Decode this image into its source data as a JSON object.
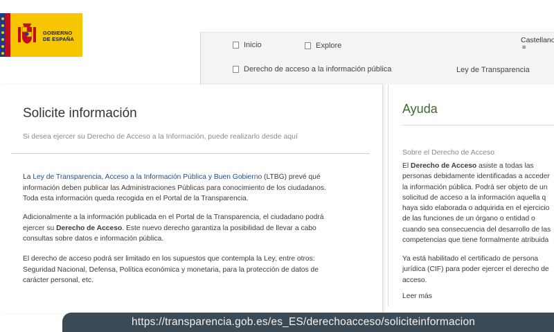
{
  "logo": {
    "line1": "GOBIERNO",
    "line2": "DE ESPAÑA",
    "colors": {
      "background": "#f6c700",
      "eu_blue": "#1f3b8c",
      "red": "#c60b1e"
    }
  },
  "nav": {
    "items": [
      {
        "label": "Inicio"
      },
      {
        "label": "Explore"
      },
      {
        "label": "Derecho de acceso a la información pública"
      },
      {
        "label": "Ley de Transparencia"
      }
    ],
    "language": "Castellano"
  },
  "main": {
    "title": "Solicite información",
    "subtitle": "Si desea ejercer su Derecho de Acceso a la Información, puede realizarlo desde aquí",
    "p1": {
      "before": "La ",
      "link": "Ley de Transparencia, Acceso a la Información Pública y Buen Gobierno",
      "line1_after": " (LTBG) prevé qué",
      "line2": "información deben publicar las Administraciones Públicas para conocimiento de los ciudadanos.",
      "line3": "Toda esta información queda recogida en el Portal de la Transparencia."
    },
    "p2": {
      "line1": "Adicionalmente a la información publicada en el Portal de la Transparencia, el ciudadano podrá",
      "line2_before": "ejercer su ",
      "line2_bold": "Derecho de Acceso",
      "line2_after": ". Este nuevo derecho garantiza la posibilidad de llevar a cabo",
      "line3": "consultas sobre datos e información pública."
    },
    "p3": {
      "line1": "El derecho de acceso podrá ser limitado en los supuestos que contempla la Ley, entre otros:",
      "line2": "Seguridad Nacional, Defensa, Política económica y monetaria, para la protección de datos de",
      "line3": "carácter personal, etc."
    }
  },
  "help": {
    "title": "Ayuda",
    "section_title": "Sobre el Derecho de Acceso",
    "p1": {
      "line1_before": "El ",
      "line1_bold": "Derecho de Acceso",
      "line1_after": " asiste a todas las",
      "line2": "personas debidamente identificadas a acceder",
      "line3": "la información pública. Podrá ser objeto de un",
      "line4": "solicitud de acceso a la información aquella q",
      "line5": "haya sido elaborada o adquirida en el ejercicio",
      "line6": "de las funciones de un órgano o entidad o",
      "line7": "cuando sea consecuencia del desarrollo de las",
      "line8": "competencias que tiene formalmente atribuida"
    },
    "p2": {
      "line1": "Ya está habilitado el certificado de persona",
      "line2": "jurídica (CIF) para poder ejercer el derecho de",
      "line3": "acceso."
    },
    "more_label": "Leer más"
  },
  "url": "https://transparencia.gob.es/es_ES/derechoacceso/soliciteinformacion"
}
